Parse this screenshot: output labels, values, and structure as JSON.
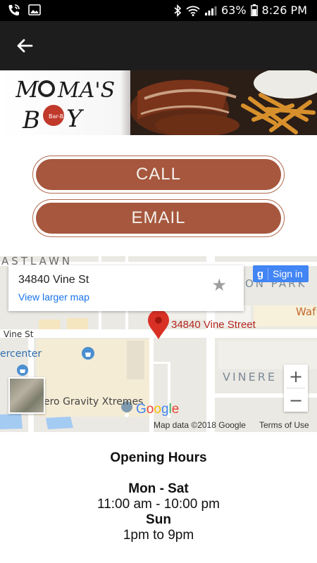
{
  "status_bar": {
    "battery": "63%",
    "time": "8:26 PM"
  },
  "banner": {
    "logo_text": "MOMA'S BOY",
    "logo_sub": "Bar-B-Q"
  },
  "actions": {
    "call_label": "CALL",
    "email_label": "EMAIL"
  },
  "map": {
    "card_address": "34840 Vine St",
    "card_link": "View larger map",
    "signin_label": "Sign in",
    "pin_label": "34840 Vine Street",
    "attribution": "Map data ©2018 Google",
    "terms": "Terms of Use",
    "labels": {
      "eastlawn": "ASTLAWN",
      "vine_st": "Vine St",
      "ercenter": "ercenter",
      "gravity": "ero Gravity Xtremes",
      "vinere": "VINERE",
      "on_park": "ON PARK",
      "waf": "Waf"
    },
    "colors": {
      "pin": "#d93025",
      "link": "#1a73e8",
      "signin": "#4285f4"
    }
  },
  "hours": {
    "title": "Opening Hours",
    "schedule": [
      {
        "days": "Mon - Sat",
        "time": "11:00 am - 10:00 pm"
      },
      {
        "days": "Sun",
        "time": "1pm to 9pm"
      }
    ]
  },
  "theme": {
    "button_color": "#a6573d",
    "app_bar": "#1d1d1d"
  }
}
